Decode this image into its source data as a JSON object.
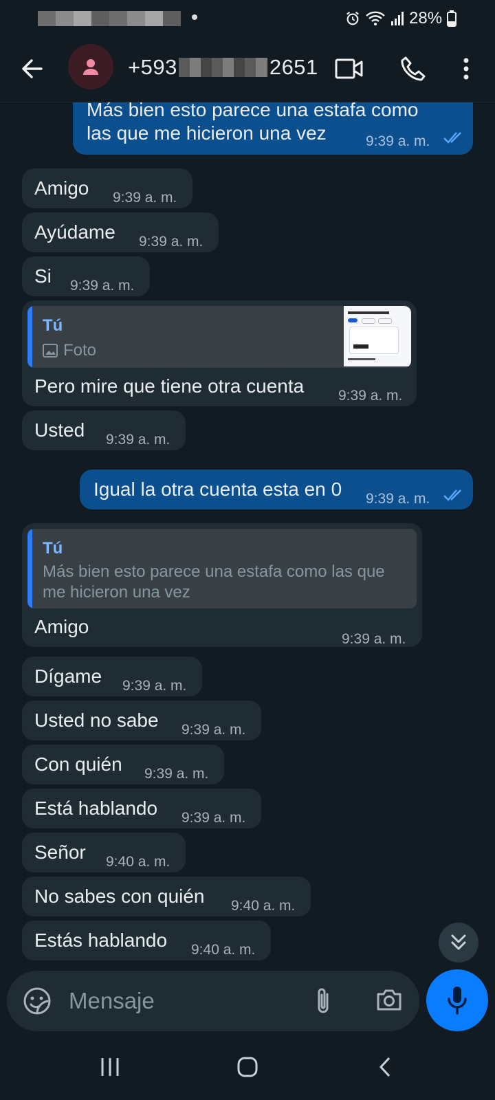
{
  "status_bar": {
    "battery_text": "28%"
  },
  "header": {
    "contact_name_start": "+593",
    "contact_name_end": "2651"
  },
  "messages": [
    {
      "direction": "out",
      "text": "Más bien esto parece una estafa como las que me hicieron una vez",
      "time": "9:39 a. m."
    },
    {
      "direction": "in",
      "text": "Amigo",
      "time": "9:39 a. m."
    },
    {
      "direction": "in",
      "text": "Ayúdame",
      "time": "9:39 a. m."
    },
    {
      "direction": "in",
      "text": "Si",
      "time": "9:39 a. m."
    },
    {
      "direction": "in",
      "text": "Pero mire que tiene otra cuenta",
      "time": "9:39 a. m.",
      "quote": {
        "author": "Tú",
        "text": "Foto"
      }
    },
    {
      "direction": "in",
      "text": "Usted",
      "time": "9:39 a. m."
    },
    {
      "direction": "out",
      "text": "Igual la otra cuenta esta en 0",
      "time": "9:39 a. m."
    },
    {
      "direction": "in",
      "text": "Amigo",
      "time": "9:39 a. m.",
      "quote": {
        "author": "Tú",
        "text": "Más bien esto parece una estafa como las que me hicieron una vez"
      }
    },
    {
      "direction": "in",
      "text": "Dígame",
      "time": "9:39 a. m."
    },
    {
      "direction": "in",
      "text": "Usted no sabe",
      "time": "9:39 a. m."
    },
    {
      "direction": "in",
      "text": "Con quién",
      "time": "9:39 a. m."
    },
    {
      "direction": "in",
      "text": "Está hablando",
      "time": "9:39 a. m."
    },
    {
      "direction": "in",
      "text": "Señor",
      "time": "9:40 a. m."
    },
    {
      "direction": "in",
      "text": "No sabes con quién",
      "time": "9:40 a. m."
    },
    {
      "direction": "in",
      "text": "Estás hablando",
      "time": "9:40 a. m."
    }
  ],
  "composer": {
    "placeholder": "Mensaje"
  },
  "colors": {
    "background": "#121b22",
    "incoming_bubble": "#202c33",
    "outgoing_bubble": "#0b4f8e",
    "accent": "#0a7cff"
  }
}
